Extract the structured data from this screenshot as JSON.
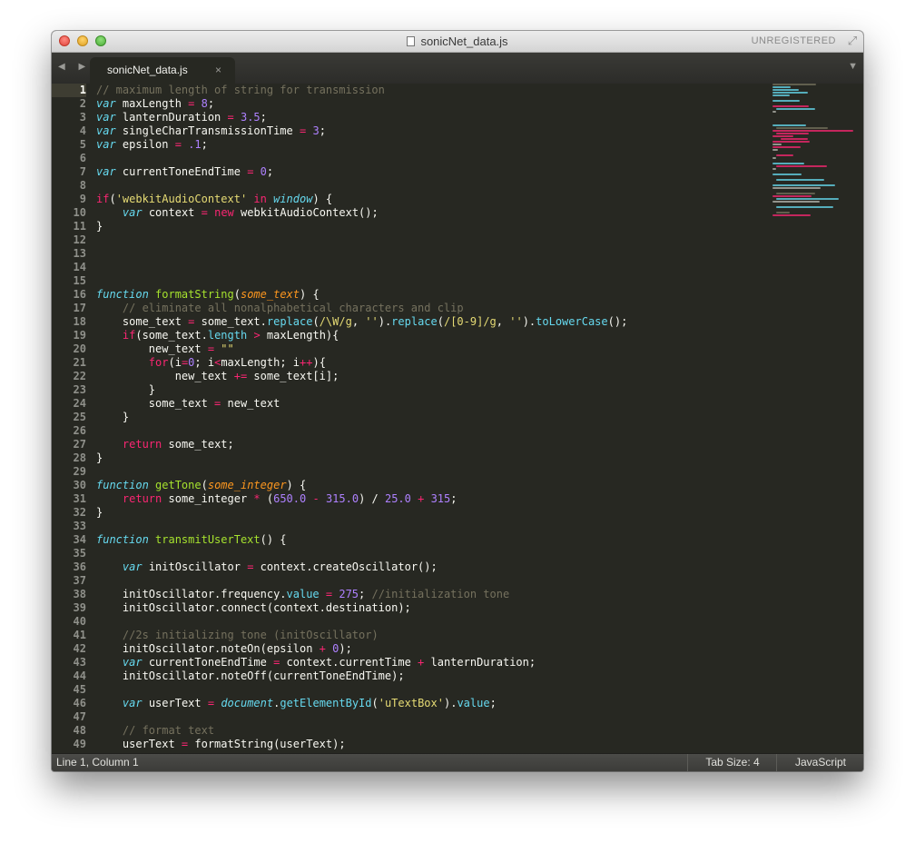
{
  "window": {
    "title": "sonicNet_data.js",
    "unregistered": "UNREGISTERED",
    "nav_arrows": "◀ ▶",
    "overflow_arrow": "▼"
  },
  "tab": {
    "label": "sonicNet_data.js",
    "close": "×"
  },
  "status": {
    "position": "Line 1, Column 1",
    "tab_size": "Tab Size: 4",
    "syntax": "JavaScript"
  },
  "editor": {
    "current_line": 1,
    "lines": [
      [
        [
          "c",
          "// maximum length of string for transmission"
        ]
      ],
      [
        [
          "sv",
          "var"
        ],
        [
          "t",
          " maxLength "
        ],
        [
          "k",
          "="
        ],
        [
          "t",
          " "
        ],
        [
          "n",
          "8"
        ],
        [
          "t",
          ";"
        ]
      ],
      [
        [
          "sv",
          "var"
        ],
        [
          "t",
          " lanternDuration "
        ],
        [
          "k",
          "="
        ],
        [
          "t",
          " "
        ],
        [
          "n",
          "3.5"
        ],
        [
          "t",
          ";"
        ]
      ],
      [
        [
          "sv",
          "var"
        ],
        [
          "t",
          " singleCharTransmissionTime "
        ],
        [
          "k",
          "="
        ],
        [
          "t",
          " "
        ],
        [
          "n",
          "3"
        ],
        [
          "t",
          ";"
        ]
      ],
      [
        [
          "sv",
          "var"
        ],
        [
          "t",
          " epsilon "
        ],
        [
          "k",
          "="
        ],
        [
          "t",
          " "
        ],
        [
          "n",
          ".1"
        ],
        [
          "t",
          ";"
        ]
      ],
      [],
      [
        [
          "sv",
          "var"
        ],
        [
          "t",
          " currentToneEndTime "
        ],
        [
          "k",
          "="
        ],
        [
          "t",
          " "
        ],
        [
          "n",
          "0"
        ],
        [
          "t",
          ";"
        ]
      ],
      [],
      [
        [
          "k",
          "if"
        ],
        [
          "t",
          "("
        ],
        [
          "s",
          "'webkitAudioContext'"
        ],
        [
          "t",
          " "
        ],
        [
          "k",
          "in"
        ],
        [
          "t",
          " "
        ],
        [
          "sv",
          "window"
        ],
        [
          "t",
          ") {"
        ]
      ],
      [
        [
          "t",
          "    "
        ],
        [
          "sv",
          "var"
        ],
        [
          "t",
          " context "
        ],
        [
          "k",
          "="
        ],
        [
          "t",
          " "
        ],
        [
          "k",
          "new"
        ],
        [
          "t",
          " webkitAudioContext();"
        ]
      ],
      [
        [
          "t",
          "}"
        ]
      ],
      [],
      [],
      [],
      [],
      [
        [
          "sv",
          "function"
        ],
        [
          "t",
          " "
        ],
        [
          "fn",
          "formatString"
        ],
        [
          "t",
          "("
        ],
        [
          "p",
          "some_text"
        ],
        [
          "t",
          ") {"
        ]
      ],
      [
        [
          "t",
          "    "
        ],
        [
          "c",
          "// eliminate all nonalphabetical characters and clip"
        ]
      ],
      [
        [
          "t",
          "    some_text "
        ],
        [
          "k",
          "="
        ],
        [
          "t",
          " some_text."
        ],
        [
          "sf",
          "replace"
        ],
        [
          "t",
          "("
        ],
        [
          "s",
          "/\\W/g"
        ],
        [
          "t",
          ", "
        ],
        [
          "s",
          "''"
        ],
        [
          "t",
          ")."
        ],
        [
          "sf",
          "replace"
        ],
        [
          "t",
          "("
        ],
        [
          "s",
          "/[0-9]/g"
        ],
        [
          "t",
          ", "
        ],
        [
          "s",
          "''"
        ],
        [
          "t",
          ")."
        ],
        [
          "sf",
          "toLowerCase"
        ],
        [
          "t",
          "();"
        ]
      ],
      [
        [
          "t",
          "    "
        ],
        [
          "k",
          "if"
        ],
        [
          "t",
          "(some_text."
        ],
        [
          "sf",
          "length"
        ],
        [
          "t",
          " "
        ],
        [
          "k",
          ">"
        ],
        [
          "t",
          " maxLength){"
        ]
      ],
      [
        [
          "t",
          "        new_text "
        ],
        [
          "k",
          "="
        ],
        [
          "t",
          " "
        ],
        [
          "s",
          "\"\""
        ]
      ],
      [
        [
          "t",
          "        "
        ],
        [
          "k",
          "for"
        ],
        [
          "t",
          "(i"
        ],
        [
          "k",
          "="
        ],
        [
          "n",
          "0"
        ],
        [
          "t",
          "; i"
        ],
        [
          "k",
          "<"
        ],
        [
          "t",
          "maxLength; i"
        ],
        [
          "k",
          "++"
        ],
        [
          "t",
          "){"
        ]
      ],
      [
        [
          "t",
          "            new_text "
        ],
        [
          "k",
          "+="
        ],
        [
          "t",
          " some_text[i];"
        ]
      ],
      [
        [
          "t",
          "        }"
        ]
      ],
      [
        [
          "t",
          "        some_text "
        ],
        [
          "k",
          "="
        ],
        [
          "t",
          " new_text"
        ]
      ],
      [
        [
          "t",
          "    }"
        ]
      ],
      [],
      [
        [
          "t",
          "    "
        ],
        [
          "k",
          "return"
        ],
        [
          "t",
          " some_text;"
        ]
      ],
      [
        [
          "t",
          "}"
        ]
      ],
      [],
      [
        [
          "sv",
          "function"
        ],
        [
          "t",
          " "
        ],
        [
          "fn",
          "getTone"
        ],
        [
          "t",
          "("
        ],
        [
          "p",
          "some_integer"
        ],
        [
          "t",
          ") {"
        ]
      ],
      [
        [
          "t",
          "    "
        ],
        [
          "k",
          "return"
        ],
        [
          "t",
          " some_integer "
        ],
        [
          "k",
          "*"
        ],
        [
          "t",
          " ("
        ],
        [
          "n",
          "650.0"
        ],
        [
          "t",
          " "
        ],
        [
          "k",
          "-"
        ],
        [
          "t",
          " "
        ],
        [
          "n",
          "315.0"
        ],
        [
          "t",
          ") / "
        ],
        [
          "n",
          "25.0"
        ],
        [
          "t",
          " "
        ],
        [
          "k",
          "+"
        ],
        [
          "t",
          " "
        ],
        [
          "n",
          "315"
        ],
        [
          "t",
          ";"
        ]
      ],
      [
        [
          "t",
          "}"
        ]
      ],
      [],
      [
        [
          "sv",
          "function"
        ],
        [
          "t",
          " "
        ],
        [
          "fn",
          "transmitUserText"
        ],
        [
          "t",
          "() {"
        ]
      ],
      [],
      [
        [
          "t",
          "    "
        ],
        [
          "sv",
          "var"
        ],
        [
          "t",
          " initOscillator "
        ],
        [
          "k",
          "="
        ],
        [
          "t",
          " context.createOscillator();"
        ]
      ],
      [],
      [
        [
          "t",
          "    initOscillator.frequency."
        ],
        [
          "sf",
          "value"
        ],
        [
          "t",
          " "
        ],
        [
          "k",
          "="
        ],
        [
          "t",
          " "
        ],
        [
          "n",
          "275"
        ],
        [
          "t",
          "; "
        ],
        [
          "c",
          "//initialization tone"
        ]
      ],
      [
        [
          "t",
          "    initOscillator.connect(context.destination);"
        ]
      ],
      [],
      [
        [
          "t",
          "    "
        ],
        [
          "c",
          "//2s initializing tone (initOscillator)"
        ]
      ],
      [
        [
          "t",
          "    initOscillator.noteOn(epsilon "
        ],
        [
          "k",
          "+"
        ],
        [
          "t",
          " "
        ],
        [
          "n",
          "0"
        ],
        [
          "t",
          ");"
        ]
      ],
      [
        [
          "t",
          "    "
        ],
        [
          "sv",
          "var"
        ],
        [
          "t",
          " currentToneEndTime "
        ],
        [
          "k",
          "="
        ],
        [
          "t",
          " context.currentTime "
        ],
        [
          "k",
          "+"
        ],
        [
          "t",
          " lanternDuration;"
        ]
      ],
      [
        [
          "t",
          "    initOscillator.noteOff(currentToneEndTime);"
        ]
      ],
      [],
      [
        [
          "t",
          "    "
        ],
        [
          "sv",
          "var"
        ],
        [
          "t",
          " userText "
        ],
        [
          "k",
          "="
        ],
        [
          "t",
          " "
        ],
        [
          "sv",
          "document"
        ],
        [
          "t",
          "."
        ],
        [
          "sf",
          "getElementById"
        ],
        [
          "t",
          "("
        ],
        [
          "s",
          "'uTextBox'"
        ],
        [
          "t",
          ")."
        ],
        [
          "sf",
          "value"
        ],
        [
          "t",
          ";"
        ]
      ],
      [],
      [
        [
          "t",
          "    "
        ],
        [
          "c",
          "// format text"
        ]
      ],
      [
        [
          "t",
          "    userText "
        ],
        [
          "k",
          "="
        ],
        [
          "t",
          " formatString(userText);"
        ]
      ]
    ]
  }
}
